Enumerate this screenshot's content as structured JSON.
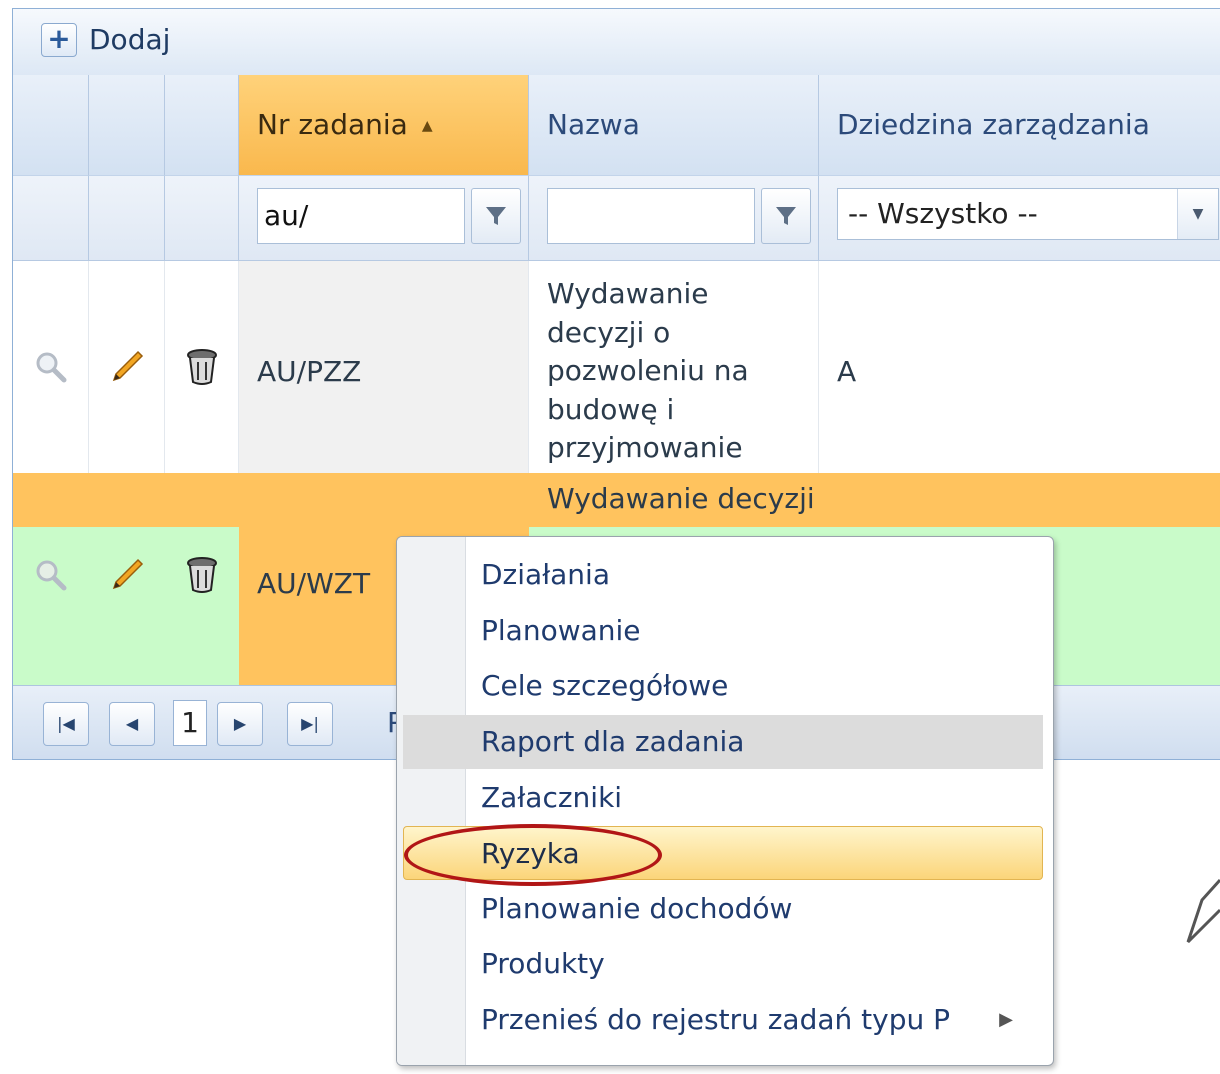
{
  "toolbar": {
    "add_label": "Dodaj"
  },
  "grid": {
    "headers": {
      "nr": "Nr zadania",
      "nazwa": "Nazwa",
      "dziedzina": "Dziedzina zarządzania"
    },
    "filters": {
      "nr_value": "au/",
      "nazwa_value": "",
      "dziedzina_selected": "-- Wszystko --"
    },
    "rows": [
      {
        "nr": "AU/PZZ",
        "nazwa": "Wydawanie decyzji o pozwoleniu na budowę i przyjmowanie zgłoszeń",
        "dziedzina": "A"
      },
      {
        "nr": "AU/WZT",
        "nazwa": "Wydawanie decyzji"
      }
    ]
  },
  "pager": {
    "current_page": "1",
    "trailing_text": "P"
  },
  "context_menu": {
    "items": [
      "Działania",
      "Planowanie",
      "Cele szczegółowe",
      "Raport dla zadania",
      "Załaczniki",
      "Ryzyka",
      "Planowanie dochodów",
      "Produkty",
      "Przenieś do rejestru zadań typu P"
    ],
    "hovered_item": "Raport dla zadania",
    "active_item": "Ryzyka"
  },
  "colors": {
    "sorted_header": "#f9b84d",
    "selected_row": "#c9fbc9",
    "selected_row_header_band": "#ffc35e",
    "highlight_ring": "#b11616"
  }
}
